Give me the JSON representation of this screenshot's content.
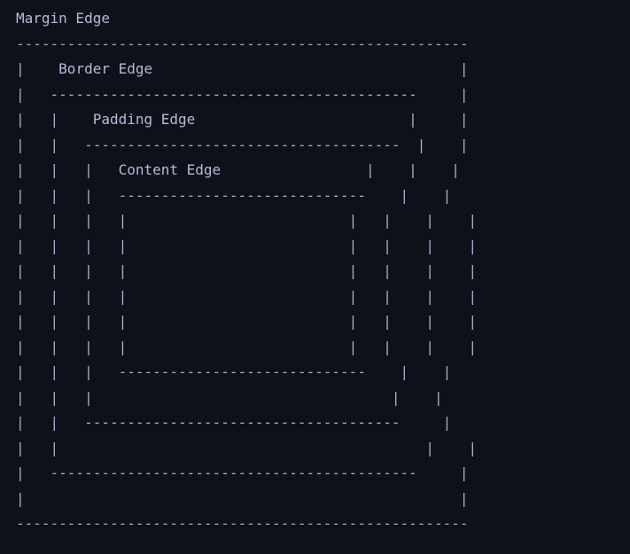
{
  "diagram": {
    "labels": {
      "margin": "Margin Edge",
      "border": "Border Edge",
      "padding": "Padding Edge",
      "content": "Content Edge"
    },
    "lines": [
      "Margin Edge",
      "-----------------------------------------------------",
      "|    Border Edge                                    |",
      "|   -------------------------------------------     |",
      "|   |    Padding Edge                         |     |",
      "|   |   -------------------------------------  |    |",
      "|   |   |   Content Edge                 |    |    |",
      "|   |   |   -----------------------------    |    |",
      "|   |   |   |                          |   |    |    |",
      "|   |   |   |                          |   |    |    |",
      "|   |   |   |                          |   |    |    |",
      "|   |   |   |                          |   |    |    |",
      "|   |   |   |                          |   |    |    |",
      "|   |   |   |                          |   |    |    |",
      "|   |   |   -----------------------------    |    |",
      "|   |   |                                   |    |",
      "|   |   -------------------------------------     |",
      "|   |                                           |    |",
      "|   -------------------------------------------     |",
      "|                                                   |",
      "-----------------------------------------------------"
    ]
  }
}
